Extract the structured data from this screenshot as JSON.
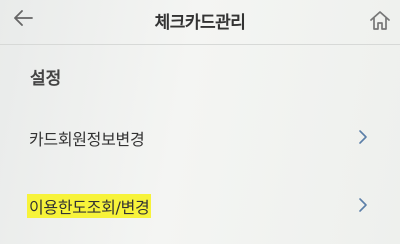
{
  "header": {
    "title": "체크카드관리",
    "back_icon": "arrow-left-icon",
    "home_icon": "home-icon"
  },
  "section": {
    "title": "설정",
    "items": [
      {
        "label": "카드회원정보변경",
        "icon": "chevron-right-icon",
        "highlighted": false
      },
      {
        "label": "이용한도조회/변경",
        "icon": "chevron-right-icon",
        "highlighted": true
      }
    ]
  },
  "colors": {
    "highlight": "#f7f33a",
    "chevron": "#5b7fa8",
    "icon": "#666666"
  }
}
